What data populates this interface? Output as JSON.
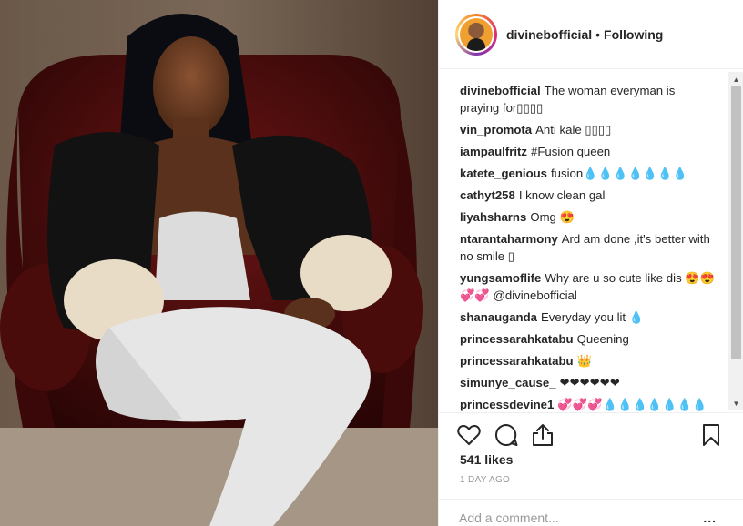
{
  "post": {
    "username": "divinebofficial",
    "separator": "•",
    "follow_state": "Following",
    "likes": "541 likes",
    "time_ago": "1 DAY AGO",
    "add_comment_placeholder": "Add a comment...",
    "more_options": "..."
  },
  "comments": [
    {
      "user": "divinebofficial",
      "text": "The woman everyman is praying for▯▯▯▯"
    },
    {
      "user": "vin_promota",
      "text": "Anti kale ▯▯▯▯"
    },
    {
      "user": "iampaulfritz",
      "text": "#Fusion queen"
    },
    {
      "user": "katete_genious",
      "text": "fusion💧💧💧💧💧💧💧"
    },
    {
      "user": "cathyt258",
      "text": "I know clean gal"
    },
    {
      "user": "liyahsharns",
      "text": "Omg 😍"
    },
    {
      "user": "ntarantaharmony",
      "text": "Ard am done ,it's better with no smile ▯"
    },
    {
      "user": "yungsamoflife",
      "text": "Why are u so cute like dis 😍😍💞💞 @divinebofficial"
    },
    {
      "user": "shanauganda",
      "text": "Everyday you lit 💧"
    },
    {
      "user": "princessarahkatabu",
      "text": "Queening"
    },
    {
      "user": "princessarahkatabu",
      "text": "👑"
    },
    {
      "user": "simunye_cause_",
      "text": "❤❤❤❤❤❤"
    },
    {
      "user": "princessdevine1",
      "text": "💞💞💞💧💧💧💧💧💧💧"
    }
  ],
  "icons": {
    "like": "heart-icon",
    "comment": "comment-icon",
    "share": "share-icon",
    "save": "bookmark-icon"
  },
  "colors": {
    "text": "#262626",
    "muted": "#999999",
    "border": "#efefef"
  }
}
